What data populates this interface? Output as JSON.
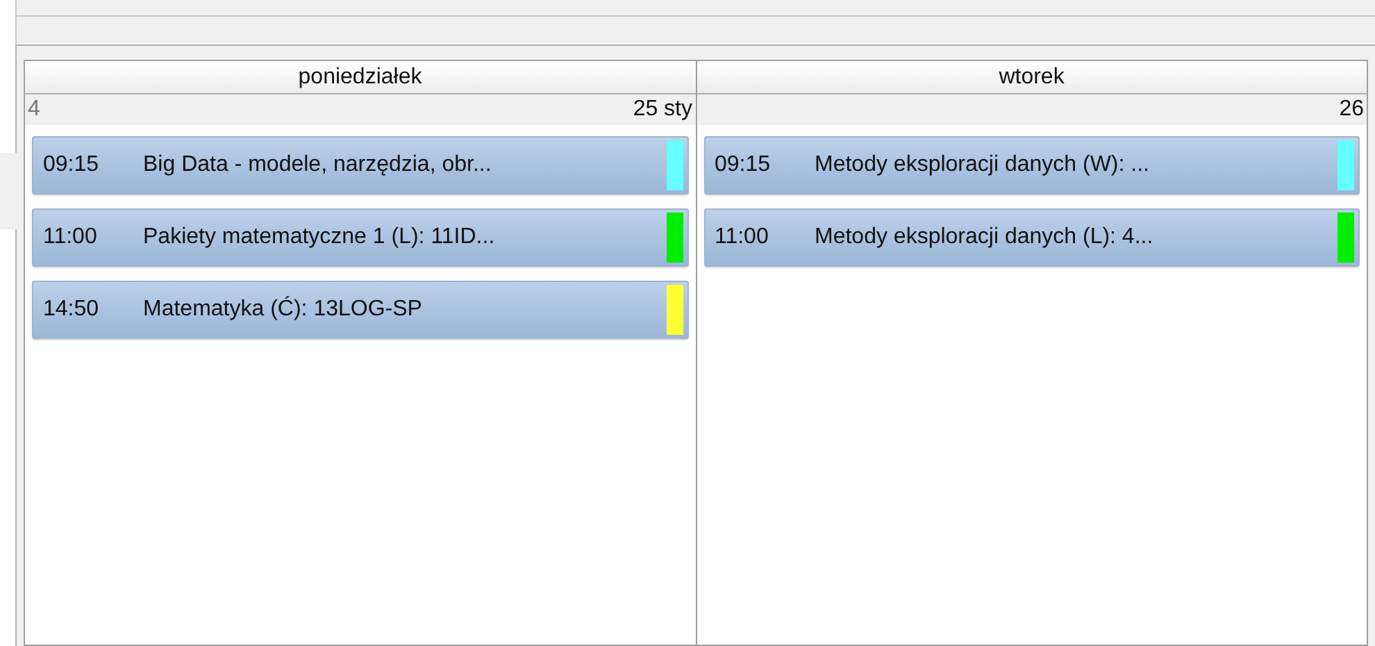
{
  "days": [
    {
      "name": "poniedziałek",
      "week": "4",
      "date": "25 sty",
      "events": [
        {
          "time": "09:15",
          "title": "Big Data - modele, narzędzia, obr...",
          "color": "#66ffff"
        },
        {
          "time": "11:00",
          "title": "Pakiety matematyczne 1 (L): 11ID...",
          "color": "#00ee00"
        },
        {
          "time": "14:50",
          "title": "Matematyka (Ć): 13LOG-SP",
          "color": "#ffff33"
        }
      ]
    },
    {
      "name": "wtorek",
      "date": "26",
      "events": [
        {
          "time": "09:15",
          "title": "Metody eksploracji danych (W): ...",
          "color": "#66ffff"
        },
        {
          "time": "11:00",
          "title": "Metody eksploracji danych (L): 4...",
          "color": "#00ee00"
        }
      ]
    }
  ]
}
